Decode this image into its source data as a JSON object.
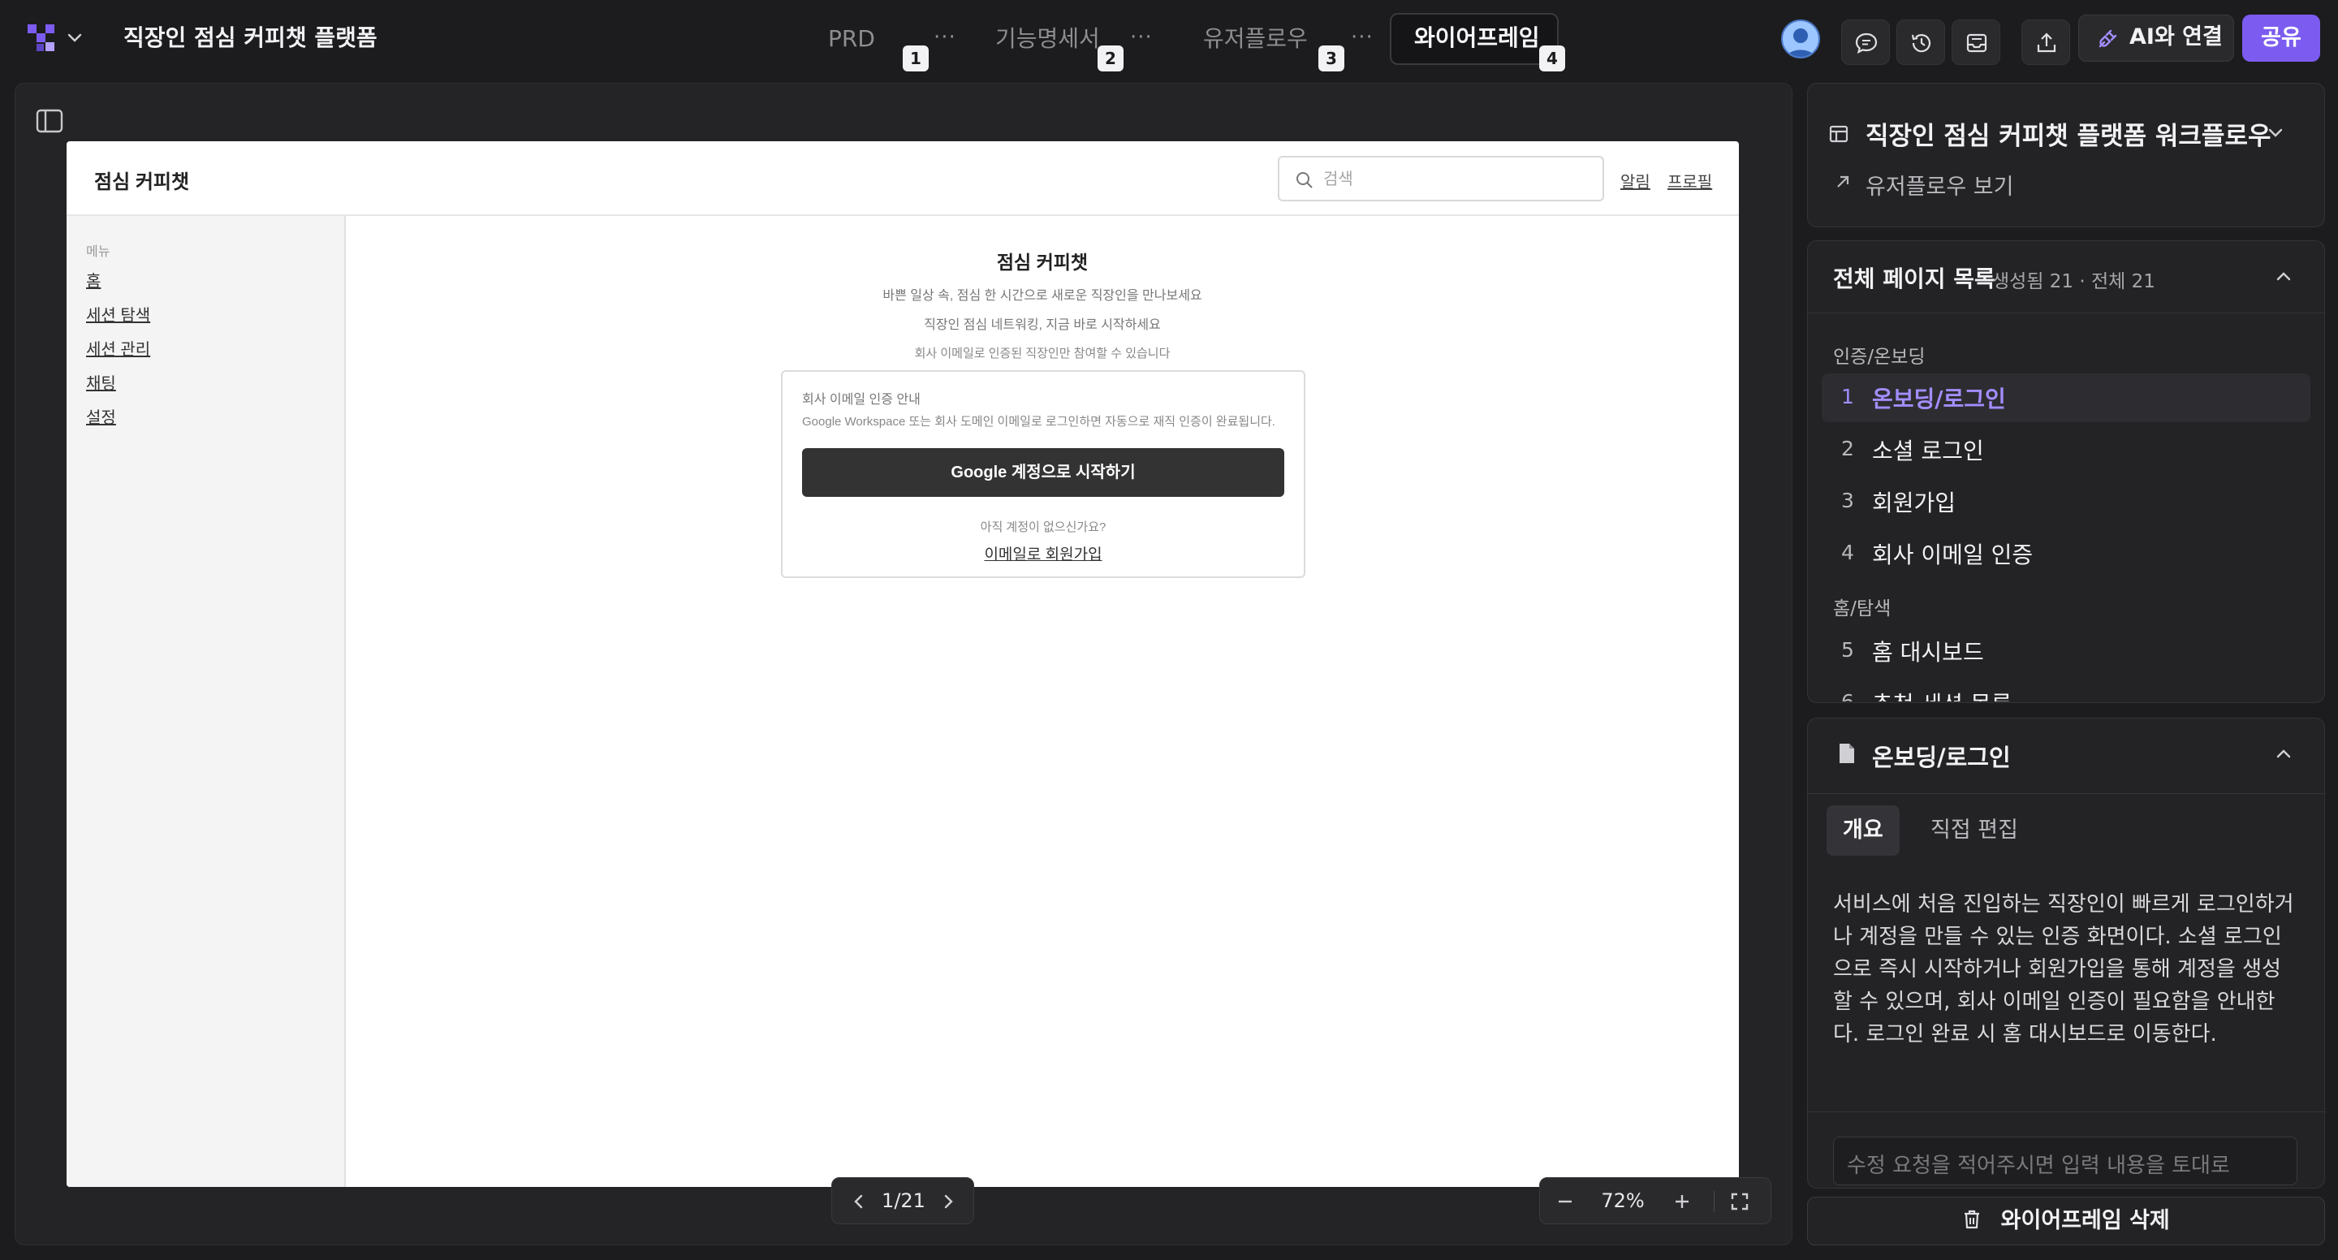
{
  "app": {
    "title": "직장인 점심 커피챗 플랫폼",
    "logo_icon": "grid-logo-icon",
    "accent": "#7c5cf0"
  },
  "tabs": [
    {
      "label": "PRD",
      "badge": "1"
    },
    {
      "label": "기능명세서",
      "badge": "2"
    },
    {
      "label": "유저플로우",
      "badge": "3"
    },
    {
      "label": "와이어프레임",
      "badge": "4",
      "active": true
    }
  ],
  "tab_more": "···",
  "toolbar": {
    "ai_label": "AI와 연결",
    "share_label": "공유"
  },
  "wireframe": {
    "brand": "점심 커피챗",
    "search_placeholder": "검색",
    "links": [
      "알림",
      "프로필"
    ],
    "menu_title": "메뉴",
    "menu": [
      "홈",
      "세션 탐색",
      "세션 관리",
      "채팅",
      "설정"
    ],
    "main_title": "점심 커피챗",
    "lines": [
      "바쁜 일상 속, 점심 한 시간으로 새로운 직장인을 만나보세요",
      "직장인 점심 네트워킹, 지금 바로 시작하세요",
      "회사 이메일로 인증된 직장인만 참여할 수 있습니다"
    ],
    "card": {
      "title": "회사 이메일 인증 안내",
      "desc": "Google Workspace 또는 회사 도메인 이메일로 로그인하면 자동으로 재직 인증이 완료됩니다.",
      "google_button": "Google 계정으로 시작하기",
      "question": "아직 계정이 없으신가요?",
      "signup_link": "이메일로 회원가입"
    }
  },
  "pager": {
    "text": "1/21"
  },
  "zoom": {
    "text": "72%"
  },
  "right_panel": {
    "flow_title": "직장인 점심 커피챗 플랫폼 워크플로우",
    "flow_link": "유저플로우 보기",
    "list_title": "전체 페이지 목록",
    "list_sub": "생성됨 21  ·  전체 21",
    "groups": [
      {
        "label": "인증/온보딩",
        "pages": [
          {
            "num": "1",
            "name": "온보딩/로그인",
            "selected": true
          },
          {
            "num": "2",
            "name": "소셜 로그인"
          },
          {
            "num": "3",
            "name": "회원가입"
          },
          {
            "num": "4",
            "name": "회사 이메일 인증"
          }
        ]
      },
      {
        "label": "홈/탐색",
        "pages": [
          {
            "num": "5",
            "name": "홈 대시보드"
          },
          {
            "num": "6",
            "name": "추천 세션 목록"
          }
        ]
      }
    ],
    "detail_title": "온보딩/로그인",
    "detail_tabs": [
      "개요",
      "직접 편집"
    ],
    "description": "서비스에 처음 진입하는 직장인이 빠르게 로그인하거나 계정을 만들 수 있는 인증 화면이다. 소셜 로그인으로 즉시 시작하거나 회원가입을 통해 계정을 생성할 수 있으며, 회사 이메일 인증이 필요함을 안내한다. 로그인 완료 시 홈 대시보드로 이동한다.",
    "request_placeholder": "수정 요청을 적어주시면 입력 내용을 토대로",
    "delete_label": "와이어프레임 삭제"
  }
}
